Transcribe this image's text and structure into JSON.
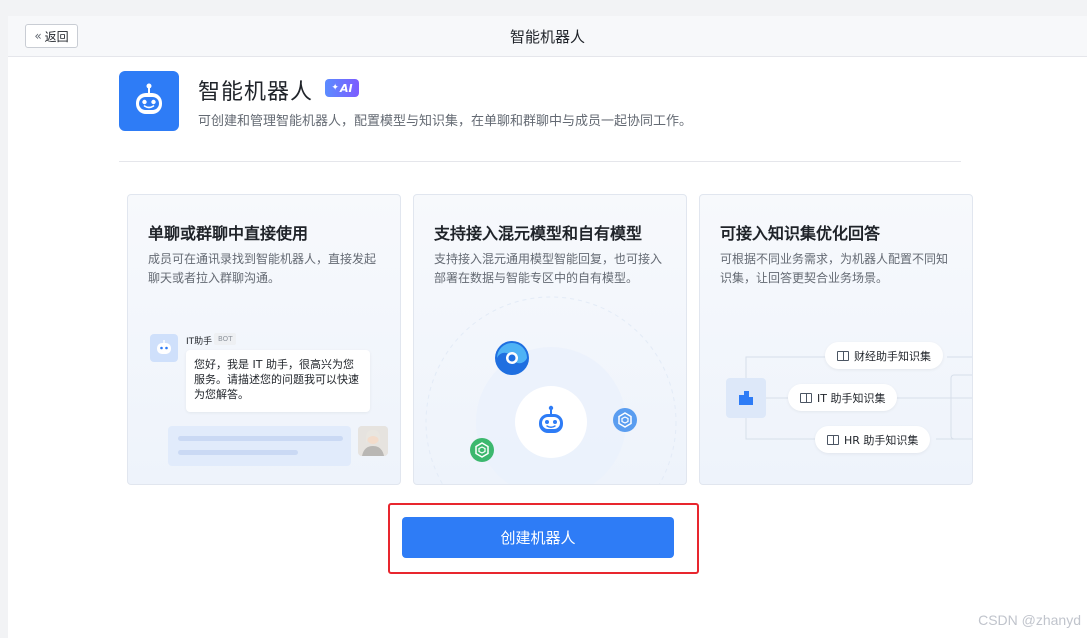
{
  "topbar": {
    "back_label": "返回",
    "title": "智能机器人"
  },
  "app": {
    "title": "智能机器人",
    "badge": "AI",
    "description": "可创建和管理智能机器人，配置模型与知识集，在单聊和群聊中与成员一起协同工作。"
  },
  "cards": [
    {
      "title": "单聊或群聊中直接使用",
      "description": "成员可在通讯录找到智能机器人，直接发起聊天或者拉入群聊沟通。",
      "chat": {
        "bot_name": "IT助手",
        "bot_tag": "BOT",
        "message": "您好，我是 IT 助手，很高兴为您服务。请描述您的问题我可以快速为您解答。"
      }
    },
    {
      "title": "支持接入混元模型和自有模型",
      "description": "支持接入混元通用模型智能回复，也可接入部署在数据与智能专区中的自有模型。"
    },
    {
      "title": "可接入知识集优化回答",
      "description": "可根据不同业务需求，为机器人配置不同知识集，让回答更契合业务场景。",
      "knowledge_sets": [
        "财经助手知识集",
        "IT 助手知识集",
        "HR 助手知识集"
      ]
    }
  ],
  "primary_button": "创建机器人",
  "watermark": "CSDN @zhanyd",
  "colors": {
    "accent": "#2e7cf6",
    "highlight": "#e8262e"
  }
}
